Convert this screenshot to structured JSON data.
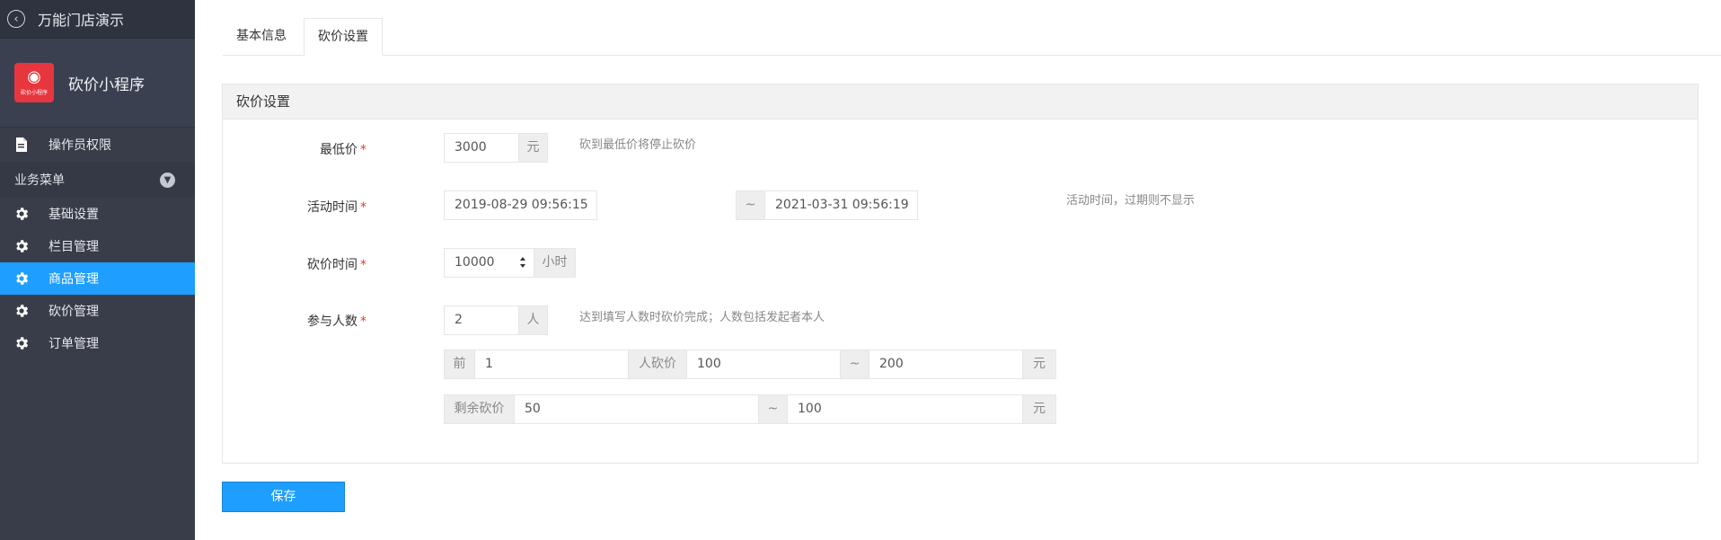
{
  "sidebar": {
    "top_title": "万能门店演示",
    "app_name": "砍价小程序",
    "app_logo_caption": "砍价小程序",
    "operator_item": "操作员权限",
    "group_label": "业务菜单",
    "items": [
      {
        "label": "基础设置",
        "icon": "gear-icon"
      },
      {
        "label": "栏目管理",
        "icon": "gear-icon"
      },
      {
        "label": "商品管理",
        "icon": "gear-icon",
        "active": true
      },
      {
        "label": "砍价管理",
        "icon": "gear-icon"
      },
      {
        "label": "订单管理",
        "icon": "gear-icon"
      }
    ],
    "active_color": "#1e9fff"
  },
  "tabs": [
    {
      "label": "基本信息"
    },
    {
      "label": "砍价设置",
      "active": true
    }
  ],
  "panel": {
    "title": "砍价设置",
    "min_price": {
      "label": "最低价",
      "value": "3000",
      "unit": "元",
      "hint": "砍到最低价将停止砍价"
    },
    "activity_time": {
      "label": "活动时间",
      "start": "2019-08-29 09:56:15",
      "separator": "~",
      "end": "2021-03-31 09:56:19",
      "hint": "活动时间，过期则不显示"
    },
    "bargain_time": {
      "label": "砍价时间",
      "value": "10000",
      "unit": "小时"
    },
    "participants": {
      "label": "参与人数",
      "value": "2",
      "unit": "人",
      "hint": "达到填写人数时砍价完成；人数包括发起者本人"
    },
    "first_range": {
      "prefix": "前",
      "count": "1",
      "mid": "人砍价",
      "min": "100",
      "separator": "~",
      "max": "200",
      "unit": "元"
    },
    "remain_range": {
      "prefix": "剩余砍价",
      "min": "50",
      "separator": "~",
      "max": "100",
      "unit": "元"
    }
  },
  "save_label": "保存"
}
